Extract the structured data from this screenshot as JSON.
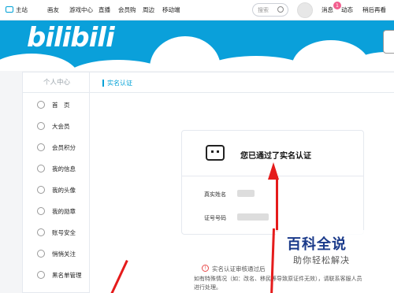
{
  "topnav": {
    "items": [
      "主站",
      "画友",
      "游戏中心",
      "直播",
      "会员购",
      "周边",
      "移动端"
    ],
    "search_placeholder": "搜索",
    "right_items": [
      "消息",
      "动态",
      "稍后再看"
    ],
    "message_count": "1"
  },
  "banner": {
    "logo_text": "bilibili"
  },
  "sidebar": {
    "title": "个人中心",
    "items": [
      {
        "label": "首　页",
        "icon": "home-icon"
      },
      {
        "label": "大会员",
        "icon": "vip-icon"
      },
      {
        "label": "会员积分",
        "icon": "points-icon"
      },
      {
        "label": "我的信息",
        "icon": "user-info-icon"
      },
      {
        "label": "我的头像",
        "icon": "avatar-icon"
      },
      {
        "label": "我的勋章",
        "icon": "medal-icon"
      },
      {
        "label": "账号安全",
        "icon": "security-icon"
      },
      {
        "label": "悄悄关注",
        "icon": "follow-icon"
      },
      {
        "label": "黑名单管理",
        "icon": "blacklist-icon"
      }
    ]
  },
  "main": {
    "section_title": "实名认证",
    "card": {
      "status": "您已通过了实名认证",
      "name_label": "真实姓名",
      "id_label": "证号号码"
    },
    "notice": "实名认证审核通过后",
    "note": "如有特殊情况（如：改名、移民等导致原证件无效），请联系客服人员进行处理。"
  },
  "watermark": {
    "title": "百科全说",
    "subtitle": "助你轻松解决"
  },
  "colors": {
    "accent": "#00a1d6",
    "banner": "#0aa0da",
    "arrow": "#e51b1b"
  }
}
